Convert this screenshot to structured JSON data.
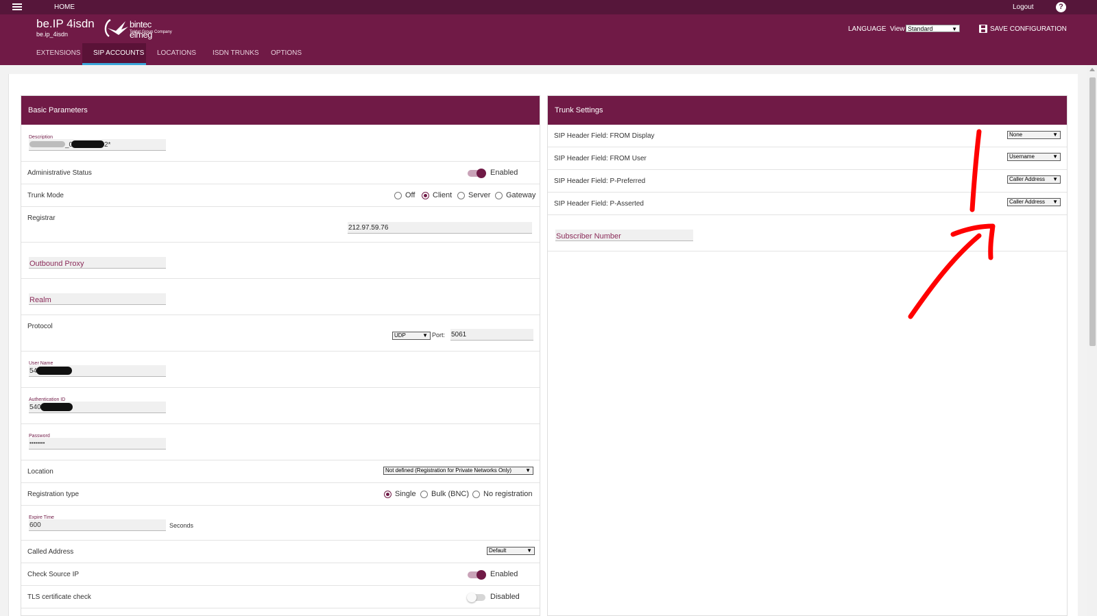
{
  "topbar": {
    "home": "HOME",
    "logout": "Logout",
    "help": "?"
  },
  "header": {
    "device_name": "be.IP 4isdn",
    "device_sub": "be.ip_4isdn",
    "logo_brand": "bintec elmeg",
    "logo_sub": "Teldat Group Company",
    "language": "LANGUAGE",
    "view_label": "View",
    "view_value": "Standard",
    "save_config": "SAVE CONFIGURATION"
  },
  "tabs": [
    {
      "label": "EXTENSIONS"
    },
    {
      "label": "SIP ACCOUNTS"
    },
    {
      "label": "LOCATIONS"
    },
    {
      "label": "ISDN TRUNKS"
    },
    {
      "label": "OPTIONS"
    }
  ],
  "basic": {
    "title": "Basic Parameters",
    "description_label": "Description",
    "description_value_start": "",
    "description_value_mid": "_0",
    "description_value_end": "2*",
    "admin_status_label": "Administrative Status",
    "admin_status_value": "Enabled",
    "trunk_mode_label": "Trunk Mode",
    "trunk_mode_options": [
      "Off",
      "Client",
      "Server",
      "Gateway"
    ],
    "registrar_label": "Registrar",
    "registrar_value": "212.97.59.76",
    "outbound_proxy_placeholder": "Outbound Proxy",
    "realm_placeholder": "Realm",
    "protocol_label": "Protocol",
    "protocol_value": "UDP",
    "port_label": "Port:",
    "port_value": "5061",
    "username_label": "User Name",
    "username_value": "54",
    "auth_id_label": "Authentication ID",
    "auth_id_value": "540",
    "password_label": "Password",
    "password_value": "••••••••",
    "location_label": "Location",
    "location_value": "Not defined (Registration for Private Networks Only)",
    "reg_type_label": "Registration type",
    "reg_type_options": [
      "Single",
      "Bulk (BNC)",
      "No registration"
    ],
    "expire_label": "Expire Time",
    "expire_value": "600",
    "expire_unit": "Seconds",
    "called_address_label": "Called Address",
    "called_address_value": "Default",
    "check_source_label": "Check Source IP",
    "check_source_value": "Enabled",
    "tls_label": "TLS certificate check",
    "tls_value": "Disabled"
  },
  "trunk": {
    "title": "Trunk Settings",
    "rows": [
      {
        "label": "SIP Header Field: FROM Display",
        "value": "None"
      },
      {
        "label": "SIP Header Field: FROM User",
        "value": "Username"
      },
      {
        "label": "SIP Header Field: P-Preferred",
        "value": "Caller Address"
      },
      {
        "label": "SIP Header Field: P-Asserted",
        "value": "Caller Address"
      }
    ],
    "subscriber_placeholder": "Subscriber Number"
  },
  "colors": {
    "brand": "#701a46",
    "topbar": "#56163a",
    "tab_indicator": "#3aa6d9",
    "annotation": "#ff0000"
  }
}
